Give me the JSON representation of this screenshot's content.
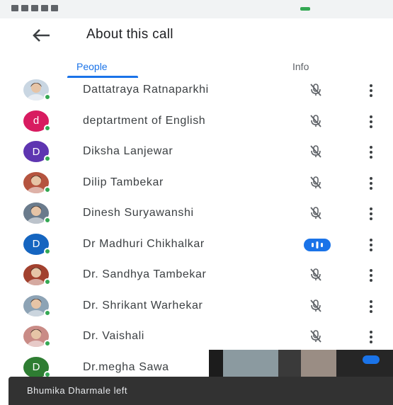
{
  "app_bar": {
    "title": "About this call"
  },
  "tabs": [
    {
      "label": "People",
      "active": true
    },
    {
      "label": "Info",
      "active": false
    }
  ],
  "participants": [
    {
      "name": "Dattatraya Ratnaparkhi",
      "avatar_type": "photo",
      "avatar_color": "#c9d6e2",
      "status": "muted"
    },
    {
      "name": "deptartment of English",
      "avatar_type": "letter",
      "avatar_letter": "d",
      "avatar_color": "#d81b60",
      "status": "muted"
    },
    {
      "name": "Diksha Lanjewar",
      "avatar_type": "letter",
      "avatar_letter": "D",
      "avatar_color": "#5e35b1",
      "status": "muted"
    },
    {
      "name": "Dilip Tambekar",
      "avatar_type": "photo",
      "avatar_color": "#b5543f",
      "status": "muted"
    },
    {
      "name": "Dinesh Suryawanshi",
      "avatar_type": "photo",
      "avatar_color": "#6a7b8c",
      "status": "muted"
    },
    {
      "name": "Dr Madhuri Chikhalkar",
      "avatar_type": "letter",
      "avatar_letter": "D",
      "avatar_color": "#1565c0",
      "status": "speaking"
    },
    {
      "name": "Dr. Sandhya Tambekar",
      "avatar_type": "photo",
      "avatar_color": "#a2412e",
      "status": "muted"
    },
    {
      "name": "Dr. Shrikant Warhekar",
      "avatar_type": "photo",
      "avatar_color": "#8da3b5",
      "status": "muted"
    },
    {
      "name": "Dr. Vaishali",
      "avatar_type": "photo",
      "avatar_color": "#c98b86",
      "status": "muted"
    },
    {
      "name": "Dr.megha Sawa",
      "avatar_type": "letter",
      "avatar_letter": "D",
      "avatar_color": "#2e7d32",
      "status": "muted"
    }
  ],
  "snackbar": {
    "text": "Bhumika Dharmale left"
  },
  "colors": {
    "accent": "#1a73e8",
    "presence": "#34a853"
  }
}
